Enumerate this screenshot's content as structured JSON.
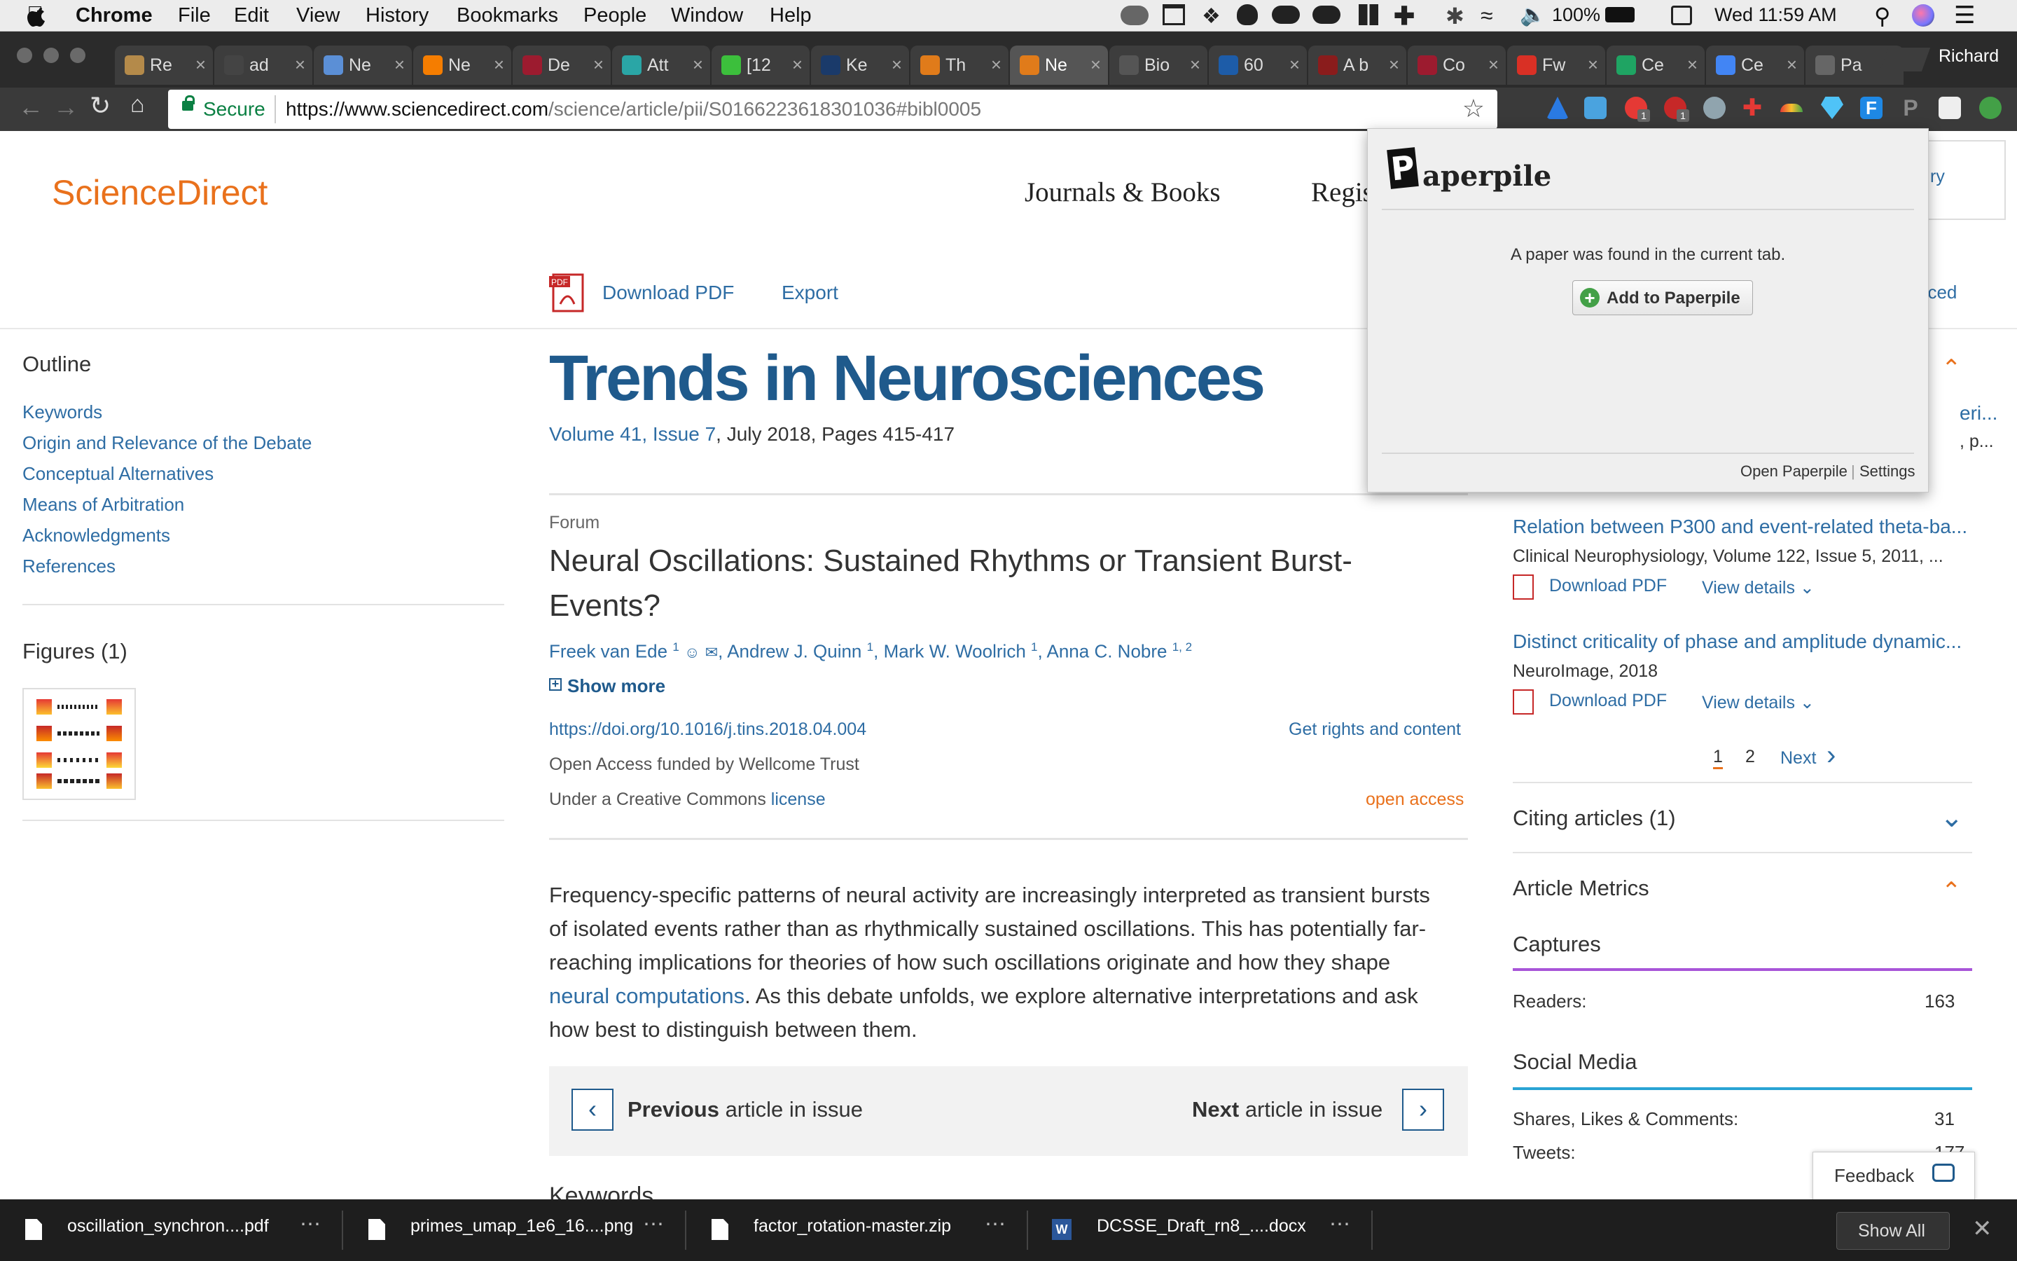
{
  "menubar": {
    "apple": "",
    "app": "Chrome",
    "items": [
      "File",
      "Edit",
      "View",
      "History",
      "Bookmarks",
      "People",
      "Window",
      "Help"
    ],
    "battery": "100%",
    "clock": "Wed 11:59 AM"
  },
  "tabs": [
    {
      "title": "Re",
      "color": "#b48a4a"
    },
    {
      "title": "ad",
      "color": "#444"
    },
    {
      "title": "Ne",
      "color": "#5b8fd6"
    },
    {
      "title": "Ne",
      "color": "#f57d00"
    },
    {
      "title": "De",
      "color": "#9c1b2f"
    },
    {
      "title": "Att",
      "color": "#2aa6a6"
    },
    {
      "title": "[12",
      "color": "#3cbf3c"
    },
    {
      "title": "Ke",
      "color": "#1a3a6a"
    },
    {
      "title": "Th",
      "color": "#e07b1a"
    },
    {
      "title": "Ne",
      "color": "#e07b1a"
    },
    {
      "title": "Bio",
      "color": "#555"
    },
    {
      "title": "60",
      "color": "#1d5ca8"
    },
    {
      "title": "A b",
      "color": "#8a1c1c"
    },
    {
      "title": "Co",
      "color": "#9c1b2f"
    },
    {
      "title": "Fw",
      "color": "#d93025"
    },
    {
      "title": "Ce",
      "color": "#1fa463"
    },
    {
      "title": "Ce",
      "color": "#4285f4"
    },
    {
      "title": "Pa",
      "color": "#666"
    }
  ],
  "profile_name": "Richard",
  "address": {
    "secure_label": "Secure",
    "url_host": "https://www.sciencedirect.com",
    "url_path": "/science/article/pii/S0166223618301036#bibl0005"
  },
  "extension_badges": [
    "1",
    "1"
  ],
  "site": {
    "logo": "ScienceDirect",
    "nav_journals": "Journals & Books",
    "nav_register": "Regis",
    "peek_right": "ry",
    "peek_advanced": "nced"
  },
  "actions": {
    "download_pdf": "Download PDF",
    "export": "Export"
  },
  "outline": {
    "title": "Outline",
    "items": [
      "Keywords",
      "Origin and Relevance of the Debate",
      "Conceptual Alternatives",
      "Means of Arbitration",
      "Acknowledgments",
      "References"
    ],
    "figures_title": "Figures (1)"
  },
  "journal": {
    "name": "Trends in Neurosciences",
    "volume_link": "Volume 41, Issue 7",
    "issue_rest": ", July 2018, Pages 415-417"
  },
  "article": {
    "type": "Forum",
    "title_line1": "Neural Oscillations: Sustained Rhythms or Transient Burst-",
    "title_line2": "Events?",
    "authors": [
      {
        "name": "Freek van Ede",
        "sup": "1"
      },
      {
        "name": "Andrew J. Quinn",
        "sup": "1"
      },
      {
        "name": "Mark W. Woolrich",
        "sup": "1"
      },
      {
        "name": "Anna C. Nobre",
        "sup": "1, 2"
      }
    ],
    "show_more": "Show more",
    "doi": "https://doi.org/10.1016/j.tins.2018.04.004",
    "rights": "Get rights and content",
    "funding": "Open Access funded by Wellcome Trust",
    "license_prefix": "Under a Creative Commons ",
    "license_link": "license",
    "open_access": "open access",
    "abstract_l1": "Frequency-specific patterns of neural activity are increasingly interpreted as transient bursts",
    "abstract_l2": "of isolated events rather than as rhythmically sustained oscillations. This has potentially far-",
    "abstract_l3": "reaching implications for theories of how such oscillations originate and how they shape",
    "abstract_l4_link": "neural computations",
    "abstract_l4_rest": ". As this debate unfolds, we explore alternative interpretations and ask",
    "abstract_l5": "how best to distinguish between them.",
    "prev_bold": "Previous",
    "prev_rest": " article in issue",
    "next_bold": "Next",
    "next_rest": " article in issue",
    "keywords_peek": "Keywords"
  },
  "recommended": {
    "item0_title": "eri...",
    "item0_meta": ", p...",
    "item1_title": "Relation between P300 and event-related theta-ba...",
    "item1_meta": "Clinical Neurophysiology, Volume 122, Issue 5, 2011, ...",
    "item2_title": "Distinct criticality of phase and amplitude dynamic...",
    "item2_meta": "NeuroImage, 2018",
    "download_pdf": "Download PDF",
    "view_details": "View details",
    "page1": "1",
    "page2": "2",
    "next": "Next"
  },
  "citing": {
    "label": "Citing articles (1)"
  },
  "metrics": {
    "title": "Article Metrics",
    "captures": "Captures",
    "readers_label": "Readers:",
    "readers_value": "163",
    "social": "Social Media",
    "shares_label": "Shares, Likes & Comments:",
    "shares_value": "31",
    "tweets_label": "Tweets:",
    "tweets_value": "177"
  },
  "feedback": "Feedback",
  "paperpile": {
    "logo_p": "P",
    "logo_rest": "aperpile",
    "message": "A paper was found in the current tab.",
    "add_button": "Add to Paperpile",
    "open": "Open Paperpile",
    "divider": "|",
    "settings": "Settings"
  },
  "downloads": {
    "files": [
      "oscillation_synchron....pdf",
      "primes_umap_1e6_16....png",
      "factor_rotation-master.zip",
      "DCSSE_Draft_rn8_....docx"
    ],
    "show_all": "Show All"
  },
  "colors": {
    "accent_orange": "#e9711c",
    "link_blue": "#2e6da4",
    "journal_blue": "#1f5a8c"
  }
}
